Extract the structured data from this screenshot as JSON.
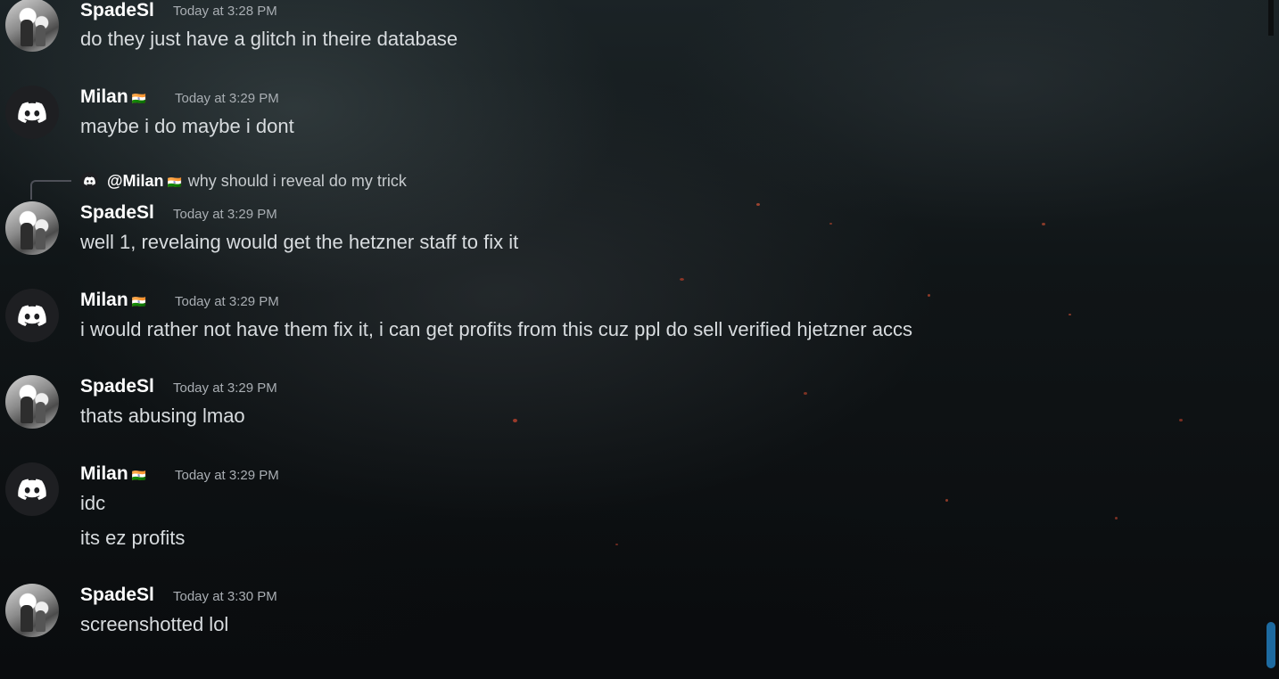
{
  "messages": [
    {
      "author": "SpadeSl",
      "avatar": "photo-avatar",
      "time": "Today at 3:28 PM",
      "lines": [
        "do they just have a glitch in theire database"
      ]
    },
    {
      "author": "Milan",
      "flag": "🇮🇳",
      "avatar": "discord-icon",
      "time": "Today at 3:29 PM",
      "lines": [
        "maybe i do maybe i dont"
      ]
    },
    {
      "author": "SpadeSl",
      "avatar": "photo-avatar",
      "time": "Today at 3:29 PM",
      "reply": {
        "mention": "@Milan",
        "flag": "🇮🇳",
        "text": "why should i reveal do my trick"
      },
      "lines": [
        "well 1, revelaing would get the hetzner staff to fix it"
      ]
    },
    {
      "author": "Milan",
      "flag": "🇮🇳",
      "avatar": "discord-icon",
      "time": "Today at 3:29 PM",
      "lines": [
        "i would rather not have them fix it, i can get profits from this cuz ppl do sell verified hjetzner accs"
      ]
    },
    {
      "author": "SpadeSl",
      "avatar": "photo-avatar",
      "time": "Today at 3:29 PM",
      "lines": [
        "thats abusing lmao"
      ]
    },
    {
      "author": "Milan",
      "flag": "🇮🇳",
      "avatar": "discord-icon",
      "time": "Today at 3:29 PM",
      "lines": [
        "idc",
        "its ez profits"
      ]
    },
    {
      "author": "SpadeSl",
      "avatar": "photo-avatar",
      "time": "Today at 3:30 PM",
      "lines": [
        "screenshotted lol"
      ]
    }
  ],
  "colors": {
    "accent_scrollbar": "#1d6aa0",
    "username": "#ffffff",
    "timestamp": "#a9aeb3",
    "message_text": "#d8dcdf"
  }
}
